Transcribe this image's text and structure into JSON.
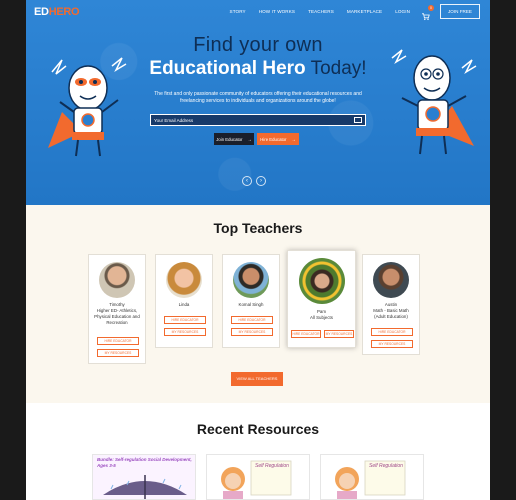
{
  "header": {
    "logo_ed": "ED",
    "logo_hero": "HERO",
    "nav": [
      "STORY",
      "HOW IT WORKS",
      "TEACHERS",
      "MARKETPLACE",
      "LOGIN"
    ],
    "cart_count": "0",
    "join_label": "JOIN FREE"
  },
  "hero": {
    "title_line1": "Find your own",
    "title_highlight": "Educational Hero",
    "title_today": "Today!",
    "subtitle": "The first and only passionate community of educators offering their educational resources and freelancing services to individuals and organizations around the globe!",
    "email_placeholder": "Your Email Address",
    "btn_educator": "Join Educator",
    "btn_hero": "Hire Educator",
    "prev_glyph": "‹",
    "next_glyph": "›"
  },
  "teachers": {
    "title": "Top Teachers",
    "view_all": "VIEW ALL TEACHERS",
    "cards": [
      {
        "name": "Timothy",
        "subject": "Higher ED- Athletics, Physical Education and Recreation",
        "hire": "HIRE EDUCATOR",
        "resources": "MY RESOURCES"
      },
      {
        "name": "Linda",
        "subject": "",
        "hire": "HIRE EDUCATOR",
        "resources": "MY RESOURCES"
      },
      {
        "name": "Komal Singh",
        "subject": "",
        "hire": "HIRE EDUCATOR",
        "resources": "MY RESOURCES"
      },
      {
        "name": "Pam",
        "subject": "All Subjects",
        "hire": "HIRE EDUCATOR",
        "resources": "MY RESOURCES"
      },
      {
        "name": "Austin",
        "subject": "Math - Basic Math (Adult Education)",
        "hire": "HIRE EDUCATOR",
        "resources": "MY RESOURCES"
      }
    ]
  },
  "resources": {
    "title": "Recent Resources",
    "items": [
      {
        "title": "Bundle: Self-regulation Social Development, Ages 3-5"
      },
      {
        "title": "Self Regulation"
      },
      {
        "title": "Self Regulation"
      }
    ]
  },
  "colors": {
    "accent": "#f26a2e",
    "hero_blue": "#2a7fd0",
    "navy": "#0e2e55",
    "cream": "#fbf7ee"
  }
}
